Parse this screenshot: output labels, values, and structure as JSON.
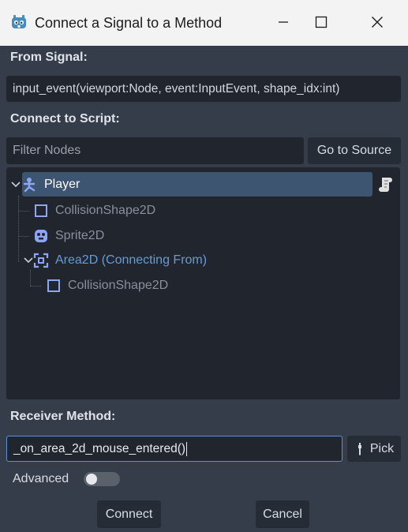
{
  "window": {
    "title": "Connect a Signal to a Method",
    "icon": "godot-icon",
    "controls": [
      "minimize-icon",
      "maximize-icon",
      "close-icon"
    ]
  },
  "from_signal": {
    "label": "From Signal:",
    "value": "input_event(viewport:Node, event:InputEvent, shape_idx:int)"
  },
  "connect_to_script": {
    "label": "Connect to Script:",
    "filter_placeholder": "Filter Nodes",
    "go_to_source_label": "Go to Source"
  },
  "tree": {
    "nodes": [
      {
        "label": "Player",
        "icon": "person-node-icon",
        "state": "selected",
        "has_script": true
      },
      {
        "label": "CollisionShape2D",
        "icon": "collision-shape-icon",
        "state": "disabled"
      },
      {
        "label": "Sprite2D",
        "icon": "sprite-icon",
        "state": "disabled"
      },
      {
        "label": "Area2D (Connecting From)",
        "icon": "area2d-icon",
        "state": "source"
      },
      {
        "label": "CollisionShape2D",
        "icon": "collision-shape-icon",
        "state": "disabled"
      }
    ]
  },
  "receiver": {
    "label": "Receiver Method:",
    "value": "_on_area_2d_mouse_entered()",
    "pick_label": "Pick"
  },
  "advanced": {
    "label": "Advanced",
    "enabled": false
  },
  "actions": {
    "connect_label": "Connect",
    "cancel_label": "Cancel"
  },
  "colors": {
    "panel_bg": "#363d4a",
    "field_bg": "#20252e",
    "selection": "#3e5572",
    "accent": "#5f8fd6",
    "source_text": "#6a9ad6",
    "disabled_text": "#8a909a"
  }
}
